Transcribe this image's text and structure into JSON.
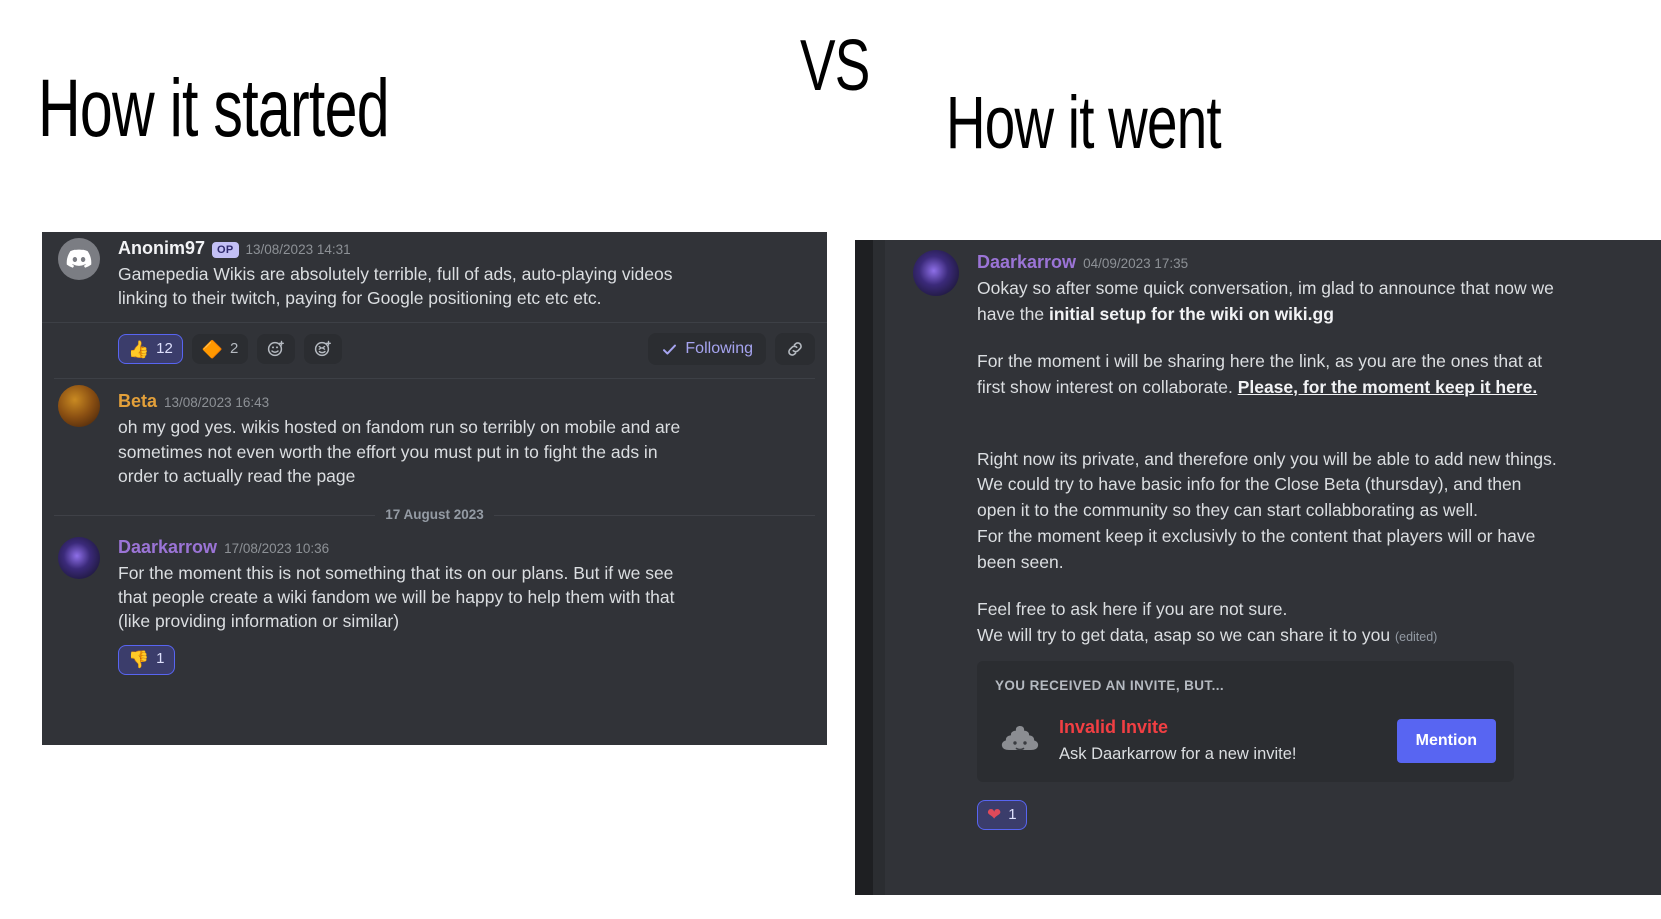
{
  "captions": {
    "left": "How it started",
    "vs": "VS",
    "right": "How it went"
  },
  "colors": {
    "discord_bg": "#313338",
    "secondary_bg": "#2b2d31",
    "blurple": "#5865f2",
    "username_purple": "#9b74d6",
    "username_gold": "#e3a03a",
    "invalid_red": "#f23f43"
  },
  "left_panel": {
    "messages": [
      {
        "author": "Anonim97",
        "badge": "OP",
        "timestamp": "13/08/2023 14:31",
        "avatar": "discord-logo-avatar",
        "text_line1": "Gamepedia Wikis are absolutely terrible, full of ads, auto-playing videos",
        "text_line2": "linking to their twitch, paying for Google positioning etc etc etc."
      },
      {
        "author": "Beta",
        "timestamp": "13/08/2023 16:43",
        "avatar": "beta-helmet-avatar",
        "text_line1": "oh my god yes. wikis hosted on fandom run so terribly on mobile and are",
        "text_line2": "sometimes not even worth the effort you must put in to fight the ads in",
        "text_line3": "order to actually read the page"
      },
      {
        "author": "Daarkarrow",
        "timestamp": "17/08/2023 10:36",
        "avatar": "daarkarrow-avatar",
        "text_line1": "For the moment this is not something that its on our plans. But if we see",
        "text_line2": "that people create a wiki fandom we will be happy to help them with that",
        "text_line3": "(like providing information or similar)"
      }
    ],
    "reactions": [
      {
        "emoji": "thumbs-up-icon",
        "glyph": "👍",
        "count": "12",
        "active": true
      },
      {
        "emoji": "diamond-icon",
        "glyph": "🔶",
        "count": "2",
        "active": false
      },
      {
        "emoji": "add-reaction-icon-1",
        "glyph": "☺",
        "count": "",
        "active": false
      },
      {
        "emoji": "add-reaction-icon-2",
        "glyph": "☻",
        "count": "",
        "active": false
      }
    ],
    "following_label": "Following",
    "date_divider": "17 August 2023",
    "downvote": {
      "emoji": "thumbs-down-icon",
      "glyph": "👎",
      "count": "1"
    }
  },
  "right_panel": {
    "message": {
      "author": "Daarkarrow",
      "timestamp": "04/09/2023 17:35",
      "avatar": "daarkarrow-avatar",
      "p1_a": "Ookay so after some quick conversation, im glad to announce that now we",
      "p1_b": "have the ",
      "p1_bold": "initial setup for the wiki on wiki.gg",
      "p2_a": "For the moment i will be sharing here the link, as you are the ones that at",
      "p2_b": "first show interest on collaborate.  ",
      "p2_underline": "Please, for the moment keep it here.",
      "p3_l1": "Right now its private, and therefore only you will be able to add new things.",
      "p3_l2": "We could try to have basic info for the Close Beta (thursday), and then",
      "p3_l3": "open it to the community so they can start collabborating as well.",
      "p3_l4": "For the moment keep it exclusivly to the content  that players will or have",
      "p3_l5": "been seen.",
      "p4_l1": "Feel free to ask here if you are not sure.",
      "p4_l2": "We will try to get data, asap so we can share it to you ",
      "edited": "(edited)"
    },
    "embed": {
      "header": "YOU RECEIVED AN INVITE, BUT...",
      "icon": "poop-icon",
      "title": "Invalid Invite",
      "subtitle": "Ask Daarkarrow for a new invite!",
      "button_label": "Mention"
    },
    "reaction": {
      "emoji": "heart-icon",
      "glyph": "❤",
      "count": "1"
    }
  }
}
